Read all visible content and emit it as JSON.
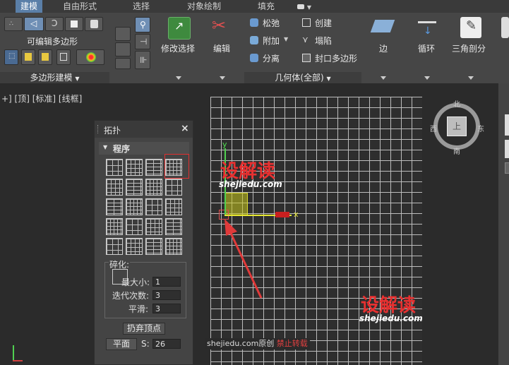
{
  "tabs": [
    {
      "label": "建模",
      "active": true
    },
    {
      "label": "自由形式",
      "active": false
    },
    {
      "label": "选择",
      "active": false
    },
    {
      "label": "对象绘制",
      "active": false
    },
    {
      "label": "填充",
      "active": false
    }
  ],
  "poly_panel": {
    "editable_poly_label": "可编辑多边形",
    "footer": "多边形建模"
  },
  "modify_panel": {
    "modify_selection": "修改选择",
    "edit": "编辑"
  },
  "geometry_panel": {
    "relax": "松弛",
    "create": "创建",
    "attach": "附加",
    "collapse": "塌陷",
    "detach": "分离",
    "cap_poly": "封口多边形",
    "footer": "几何体(全部)"
  },
  "right_panels": {
    "edge": "边",
    "loop": "循环",
    "triangulate": "三角剖分"
  },
  "viewport_label": "+] [顶] [标准] [线框]",
  "viewcube": {
    "north": "北",
    "south": "南",
    "east": "东",
    "west": "西",
    "face": "上"
  },
  "gizmo": {
    "y": "y",
    "x": "x"
  },
  "topology": {
    "title": "拓扑",
    "close": "×",
    "section": "程序",
    "fragment_label": "碎化:",
    "max_size_label": "最大小:",
    "max_size": "1",
    "iterations_label": "迭代次数:",
    "iterations": "3",
    "smooth_label": "平滑:",
    "smooth": "3",
    "discard_button": "扔弃顶点",
    "flat_button": "平面",
    "s_label": "S:",
    "s_value": "26"
  },
  "watermark": {
    "brand": "设解读",
    "url": "shejiedu.com",
    "note_prefix": "shejiedu.com原创",
    "note_warn": "禁止转载"
  },
  "colors": {
    "accent": "#5a7fa8",
    "grid": "#bdbdbd",
    "highlight": "#e03030",
    "selection": "#c8c820"
  }
}
